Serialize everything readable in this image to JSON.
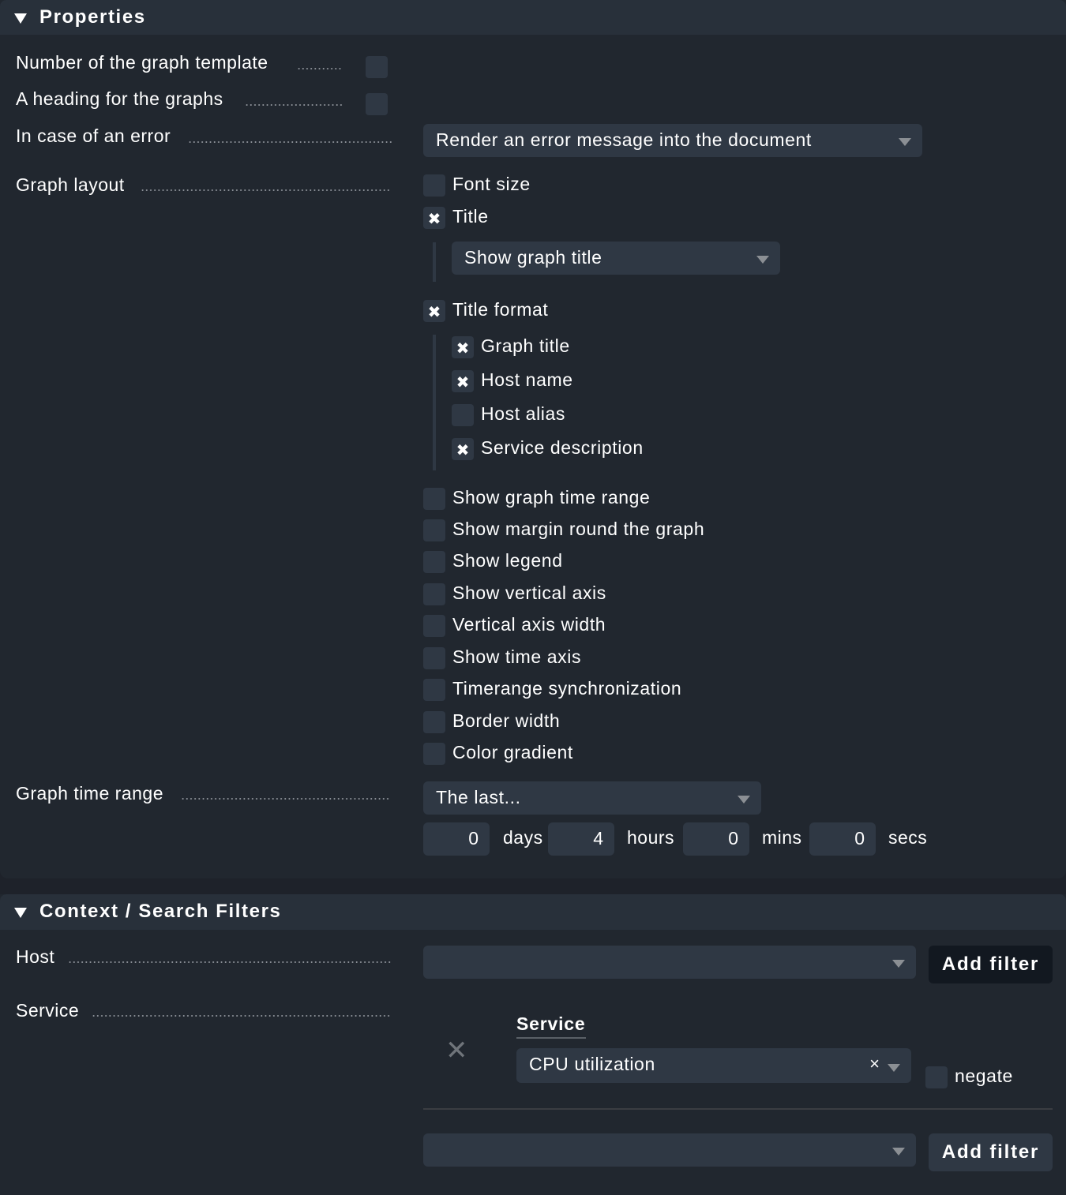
{
  "properties": {
    "title": "Properties",
    "fields": {
      "graph_template_number": {
        "label": "Number of the graph template",
        "checked": false
      },
      "graph_heading": {
        "label": "A heading for the graphs",
        "checked": false
      },
      "error_handling": {
        "label": "In case of an error",
        "selected": "Render an error message into the document"
      },
      "graph_layout": {
        "label": "Graph layout",
        "options": [
          {
            "label": "Font size",
            "checked": false
          },
          {
            "label": "Title",
            "checked": true
          },
          {
            "label": "Title format",
            "checked": true
          },
          {
            "label": "Show graph time range",
            "checked": false
          },
          {
            "label": "Show margin round the graph",
            "checked": false
          },
          {
            "label": "Show legend",
            "checked": false
          },
          {
            "label": "Show vertical axis",
            "checked": false
          },
          {
            "label": "Vertical axis width",
            "checked": false
          },
          {
            "label": "Show time axis",
            "checked": false
          },
          {
            "label": "Timerange synchronization",
            "checked": false
          },
          {
            "label": "Border width",
            "checked": false
          },
          {
            "label": "Color gradient",
            "checked": false
          }
        ],
        "title_select": "Show graph title",
        "title_format_options": [
          {
            "label": "Graph title",
            "checked": true
          },
          {
            "label": "Host name",
            "checked": true
          },
          {
            "label": "Host alias",
            "checked": false
          },
          {
            "label": "Service description",
            "checked": true
          }
        ]
      },
      "graph_time_range": {
        "label": "Graph time range",
        "selected": "The last...",
        "days": "0",
        "days_unit": "days",
        "hours": "4",
        "hours_unit": "hours",
        "mins": "0",
        "mins_unit": "mins",
        "secs": "0",
        "secs_unit": "secs"
      }
    },
    "check_glyph": "✖"
  },
  "context": {
    "title": "Context / Search Filters",
    "host": {
      "label": "Host",
      "selected": "",
      "add_filter_label": "Add filter"
    },
    "service": {
      "label": "Service",
      "filter_title": "Service",
      "remove_glyph": "✕",
      "value": "CPU utilization",
      "clear_glyph": "×",
      "negate_label": "negate",
      "negate_checked": false,
      "add_selected": "",
      "add_filter_label": "Add filter"
    }
  },
  "colors": {
    "page_bg": "#1e222a",
    "panel_bg": "#21272f",
    "header_bg": "#28303a",
    "input_bg": "#2f3844",
    "button_dark": "#121820",
    "text": "#ffffff",
    "muted": "#8b8f94"
  }
}
